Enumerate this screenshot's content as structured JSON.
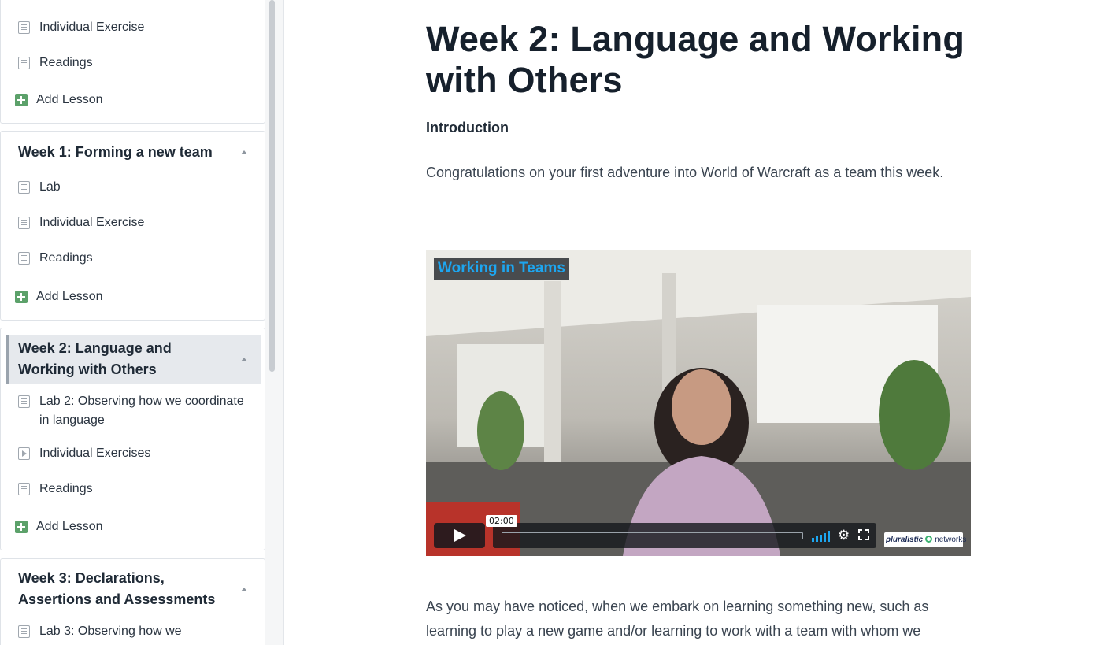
{
  "sidebar": {
    "card1": {
      "lessons": [
        {
          "label": "Individual Exercise",
          "icon": "document-icon"
        },
        {
          "label": "Readings",
          "icon": "document-icon"
        }
      ],
      "add_label": "Add Lesson"
    },
    "card2": {
      "title": "Week 1: Forming a new team",
      "lessons": [
        {
          "label": "Lab",
          "icon": "document-icon"
        },
        {
          "label": "Individual Exercise",
          "icon": "document-icon"
        },
        {
          "label": "Readings",
          "icon": "document-icon"
        }
      ],
      "add_label": "Add Lesson"
    },
    "card3": {
      "title": "Week 2: Language and Working with Others",
      "lessons": [
        {
          "label": "Lab 2: Observing how we coordinate in language",
          "icon": "document-icon"
        },
        {
          "label": "Individual Exercises",
          "icon": "video-icon"
        },
        {
          "label": "Readings",
          "icon": "document-icon"
        }
      ],
      "add_label": "Add Lesson"
    },
    "card4": {
      "title": "Week 3: Declarations, Assertions and Assessments",
      "lessons": [
        {
          "label": "Lab 3: Observing how we",
          "icon": "document-icon"
        }
      ]
    }
  },
  "main": {
    "title": "Week 2: Language and Working with Others",
    "section_heading": "Introduction",
    "intro_text": "Congratulations on your first adventure into World of Warcraft as a team this week.",
    "video": {
      "title": "Working in Teams",
      "time": "02:00",
      "progress": 0,
      "brand_name": "pluralistic",
      "brand_suffix": "networks"
    },
    "body_text": "As you may have noticed, when we embark on learning something new, such as learning to play a new game and/or learning to work with a team with whom we"
  },
  "colors": {
    "accent": "#1da6f0",
    "add_icon": "#5ca16a",
    "active_header_bg": "#e6e9ed",
    "heading_text": "#16202c"
  }
}
